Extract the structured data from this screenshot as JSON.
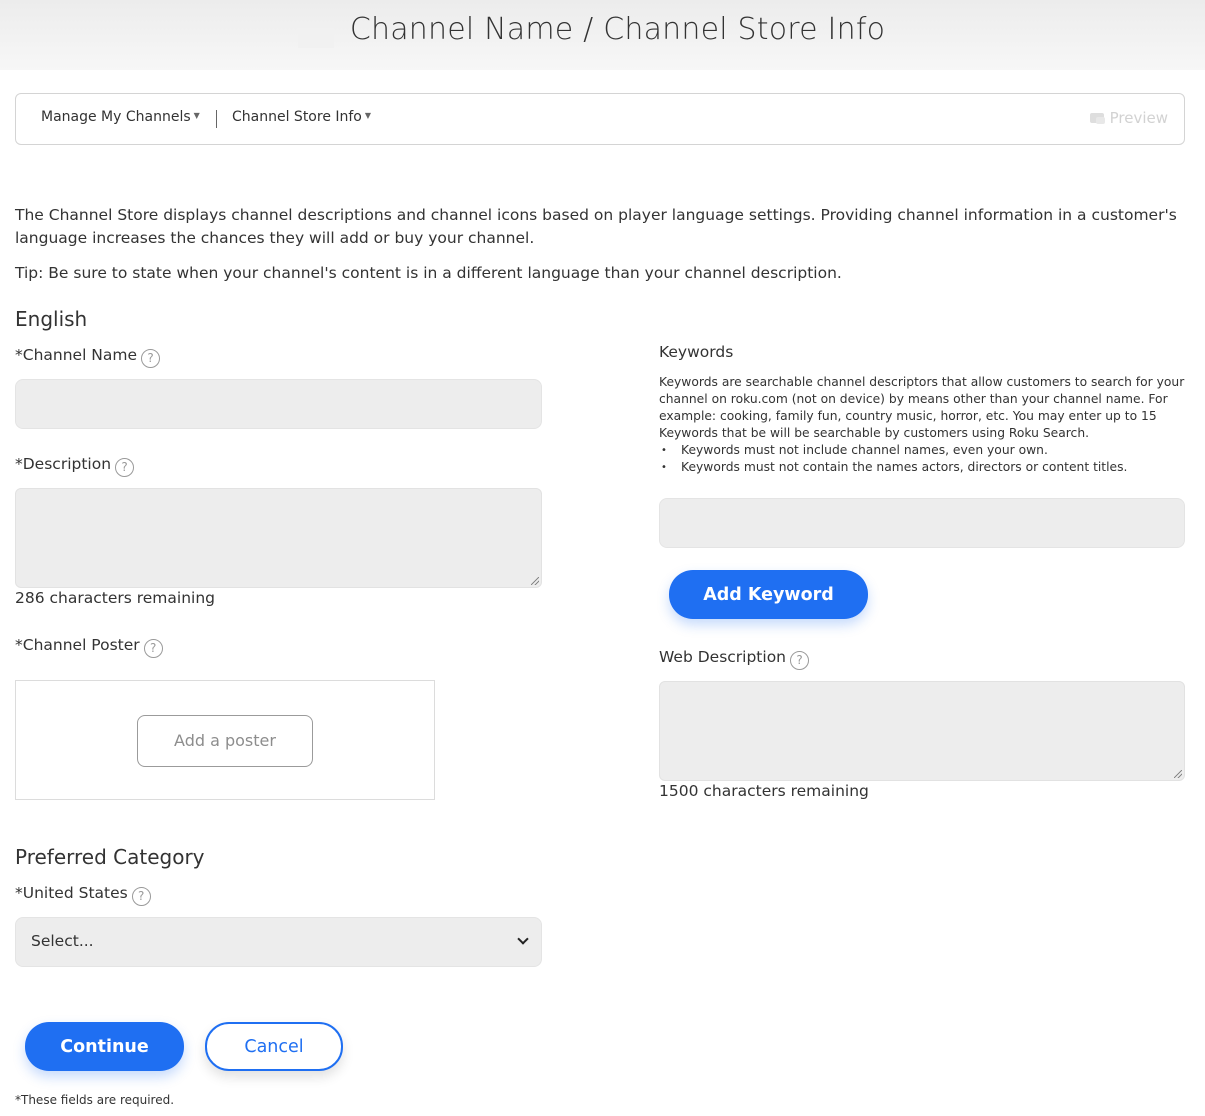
{
  "header": {
    "title": "Channel Name / Channel Store Info"
  },
  "nav": {
    "manage_label": "Manage My Channels",
    "store_info_label": "Channel Store Info",
    "preview_label": "Preview"
  },
  "intro": {
    "paragraph": "The Channel Store displays channel descriptions and channel icons based on player language settings. Providing channel information in a customer's language increases the chances they will add or buy your channel.",
    "tip": "Tip: Be sure to state when your channel's content is in a different language than your channel description."
  },
  "english": {
    "section_title": "English",
    "channel_name_label": "*Channel Name",
    "channel_name_value": "",
    "description_label": "*Description",
    "description_value": "",
    "description_counter": "286 characters remaining",
    "poster_label": "*Channel Poster",
    "poster_button": "Add a poster"
  },
  "keywords": {
    "label": "Keywords",
    "help_text": "Keywords are searchable channel descriptors that allow customers to search for your channel on roku.com (not on device) by means other than your channel name. For example: cooking, family fun, country music, horror, etc. You may enter up to 15 Keywords that be will be searchable by customers using Roku Search.",
    "rules": [
      "Keywords must not include channel names, even your own.",
      "Keywords must not contain the names actors, directors or content titles."
    ],
    "input_value": "",
    "add_button": "Add Keyword"
  },
  "web_description": {
    "label": "Web Description",
    "value": "",
    "counter": "1500 characters remaining"
  },
  "category": {
    "section_title": "Preferred Category",
    "us_label": "*United States",
    "selected": "Select..."
  },
  "actions": {
    "continue_label": "Continue",
    "cancel_label": "Cancel"
  },
  "footnote": "*These fields are required.",
  "colors": {
    "accent": "#1f6ff2",
    "input_bg": "#ededed",
    "header_bg": "#f0f0f0"
  },
  "icons": {
    "help": "question-circle-icon",
    "preview": "preview-icon",
    "caret": "chevron-down-icon"
  }
}
